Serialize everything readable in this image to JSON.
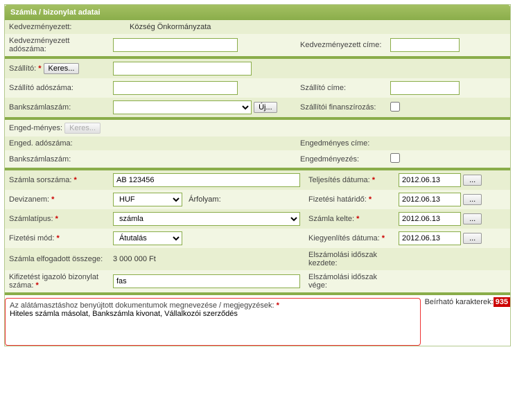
{
  "header": {
    "title": "Számla / bizonylat adatai"
  },
  "labels": {
    "kedv": "Kedvezményezett:",
    "kedv_adoszam": "Kedvezményezett adószáma:",
    "kedv_cim": "Kedvezményezett címe:",
    "szallito": "Szállító:",
    "keres": "Keres...",
    "szallito_adoszam": "Szállító adószáma:",
    "szallito_cim": "Szállító címe:",
    "bankszamla": "Bankszámlaszám:",
    "uj": "Új...",
    "szall_fin": "Szállítói finanszírozás:",
    "enged": "Enged-ményes:",
    "enged_adoszam": "Enged. adószáma:",
    "enged_cim": "Engedményes címe:",
    "engedmenyezes": "Engedményezés:",
    "szamla_sorszam": "Számla sorszáma:",
    "telj_datum": "Teljesítés dátuma:",
    "devizanem": "Devizanem:",
    "arfolyam": "Árfolyam:",
    "fiz_hatarido": "Fizetési határidő:",
    "szamlatipus": "Számlatípus:",
    "szamla_kelte": "Számla kelte:",
    "fiz_mod": "Fizetési mód:",
    "kiegy_datum": "Kiegyenlítés dátuma:",
    "elfogadott": "Számla elfogadott összege:",
    "elsz_kezd": "Elszámolási időszak kezdete:",
    "kif_biz": "Kifizetést igazoló bizonylat száma:",
    "elsz_vege": "Elszámolási időszak vége:",
    "doc_label": "Az alátámasztáshoz benyújtott dokumentumok megnevezése / megjegyzések:",
    "char_label": "Beírható karakterek:",
    "dots": "..."
  },
  "asterisk": "*",
  "values": {
    "kedv": "Község Önkormányzata",
    "kedv_adoszam": "",
    "kedv_cim": "",
    "szallito": "",
    "szallito_adoszam": "",
    "szallito_cim": "",
    "bankszamla": "",
    "enged_adoszam": "",
    "szamla_sorszam": "AB 123456",
    "telj_datum": "2012.06.13",
    "devizanem": "HUF",
    "arfolyam": "",
    "fiz_hatarido": "2012.06.13",
    "szamlatipus": "számla",
    "szamla_kelte": "2012.06.13",
    "fiz_mod": "Átutalás",
    "kiegy_datum": "2012.06.13",
    "elfogadott": "3 000 000 Ft",
    "kif_biz": "fas",
    "doc_text": "Hiteles számla másolat, Bankszámla kivonat, Vállalkozói szerződés",
    "char_count": "935"
  },
  "checks": {
    "szall_fin": false,
    "engedmenyezes": false
  }
}
